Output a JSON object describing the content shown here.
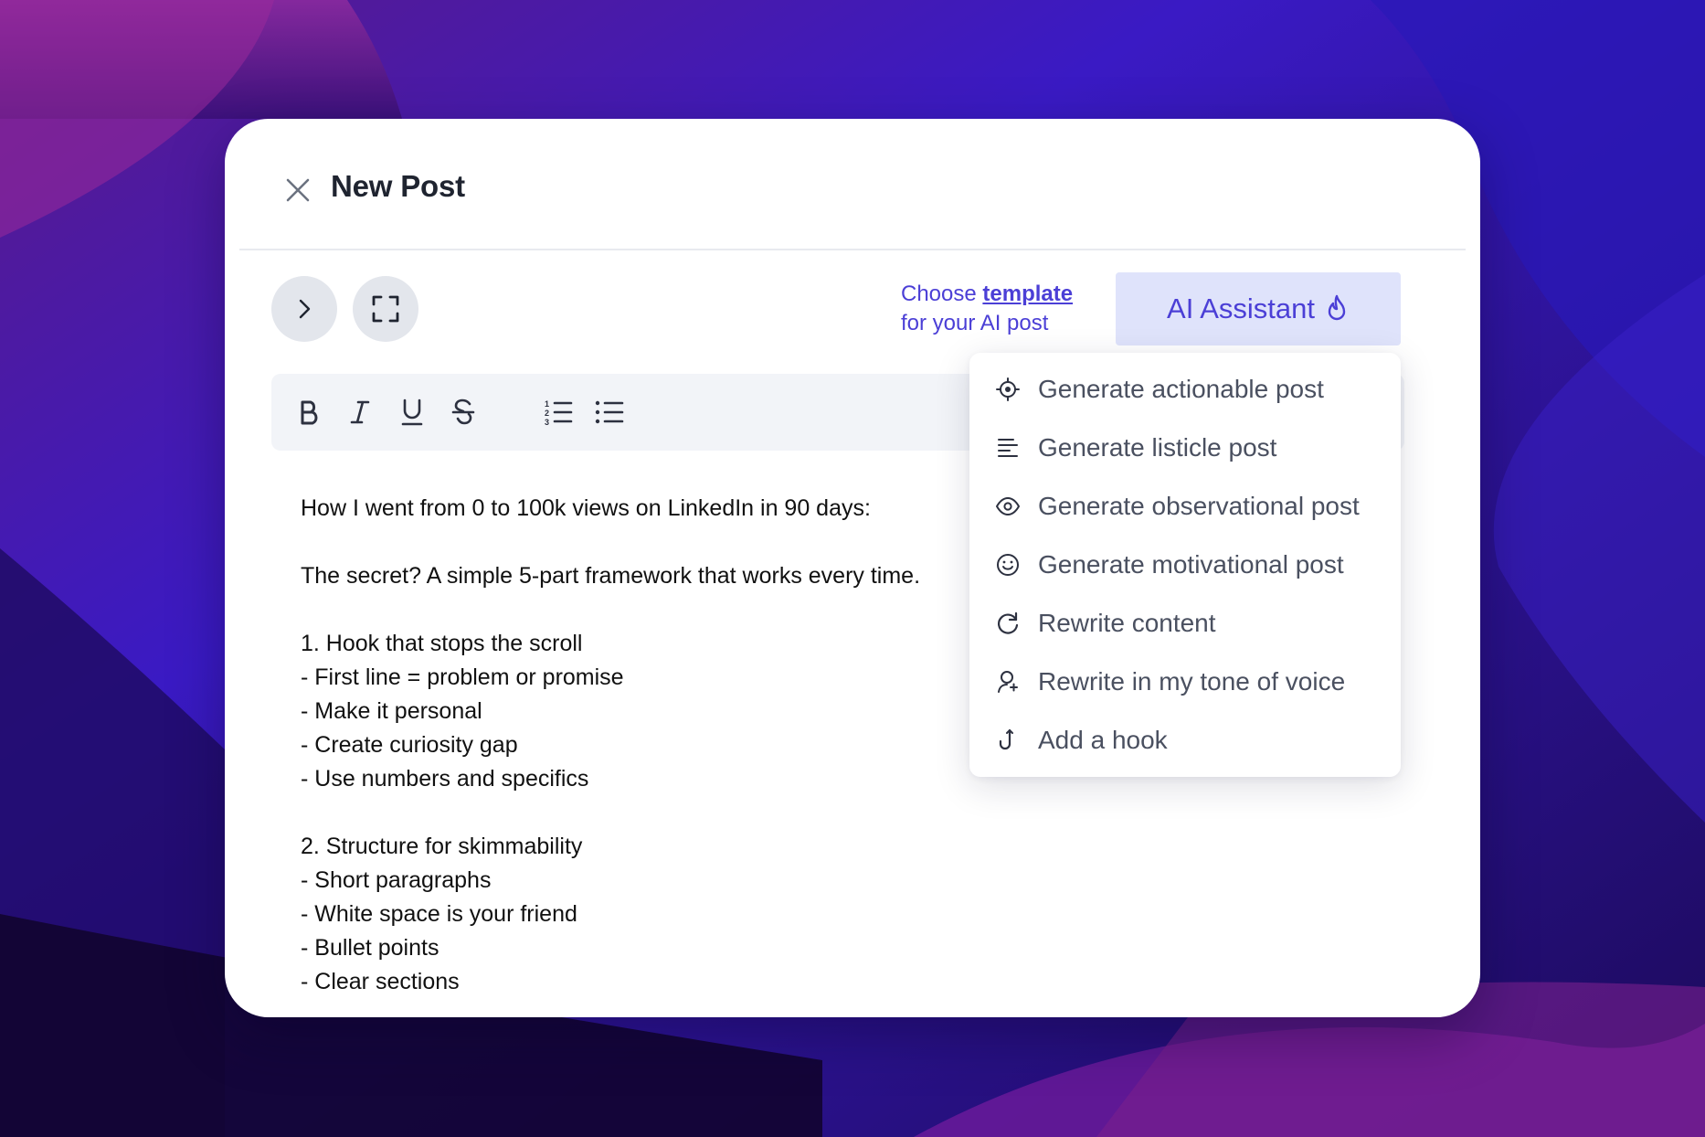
{
  "modal": {
    "title": "New Post"
  },
  "template_hint": {
    "prefix": "Choose ",
    "link": "template",
    "suffix": "for your AI post"
  },
  "ai_button": {
    "label": "AI Assistant",
    "icon": "flame-icon"
  },
  "toolbar": {
    "tools": [
      "bold-icon",
      "italic-icon",
      "underline-icon",
      "strikethrough-icon",
      "ordered-list-icon",
      "bullet-list-icon"
    ]
  },
  "editor": {
    "lines": [
      "How I went from 0 to 100k views on LinkedIn in 90 days:",
      "",
      "The secret? A simple 5-part framework that works every time.",
      "",
      "1. Hook that stops the scroll",
      "- First line = problem or promise",
      "- Make it personal",
      "- Create curiosity gap",
      "- Use numbers and specifics",
      "",
      "2. Structure for skimmability",
      "- Short paragraphs",
      "- White space is your friend",
      "- Bullet points",
      "- Clear sections"
    ]
  },
  "dropdown": {
    "items": [
      {
        "label": "Generate actionable post",
        "icon": "target-icon"
      },
      {
        "label": "Generate listicle post",
        "icon": "align-left-icon"
      },
      {
        "label": "Generate observational post",
        "icon": "eye-icon"
      },
      {
        "label": "Generate motivational post",
        "icon": "smile-icon"
      },
      {
        "label": "Rewrite content",
        "icon": "refresh-icon"
      },
      {
        "label": "Rewrite in my tone of voice",
        "icon": "user-voice-icon"
      },
      {
        "label": "Add a hook",
        "icon": "hook-icon"
      }
    ]
  },
  "colors": {
    "accent": "#4b3fd6",
    "ai_button_bg": "#dfe3fb",
    "toolbar_bg": "#f2f4f8"
  }
}
